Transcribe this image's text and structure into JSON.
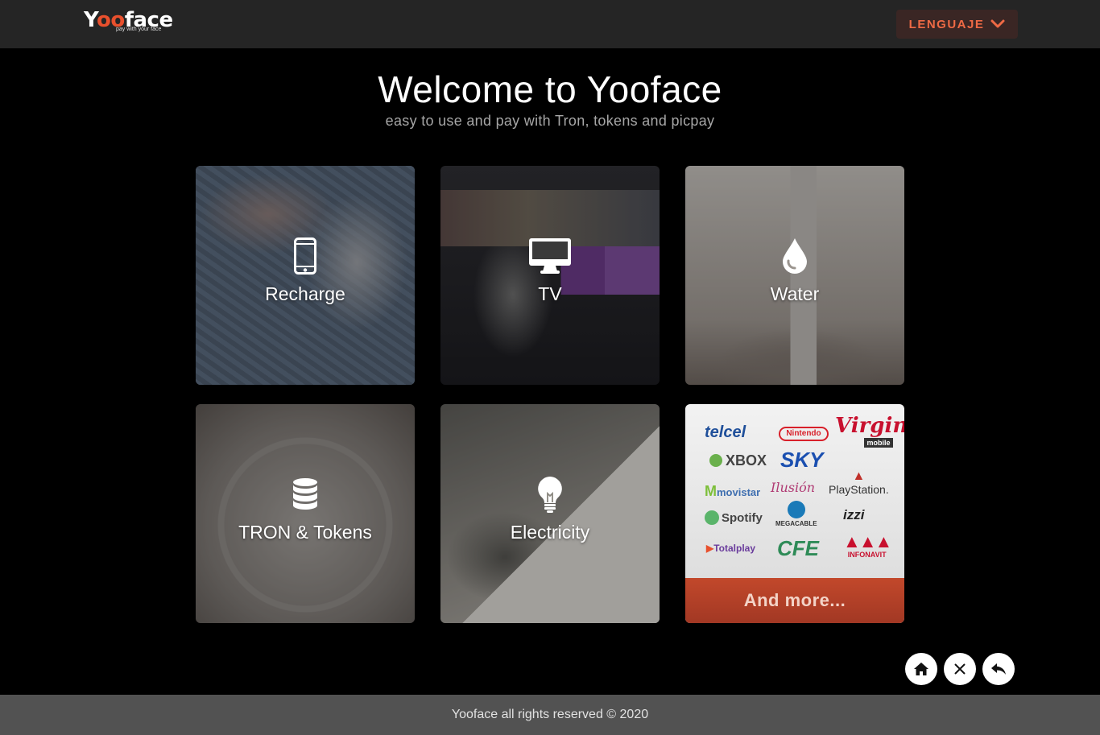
{
  "header": {
    "logo_word_start": "Y",
    "logo_word_oo": "oo",
    "logo_word_end": "face",
    "logo_tagline": "pay with your face",
    "language_button": "LENGUAJE",
    "language_icon": "chevron-down-icon"
  },
  "hero": {
    "title": "Welcome to Yooface",
    "subtitle": "easy to use and pay with Tron, tokens and picpay"
  },
  "cards": [
    {
      "label": "Recharge",
      "icon": "smartphone-icon"
    },
    {
      "label": "TV",
      "icon": "monitor-icon"
    },
    {
      "label": "Water",
      "icon": "droplet-icon"
    },
    {
      "label": "TRON & Tokens",
      "icon": "database-icon"
    },
    {
      "label": "Electricity",
      "icon": "lightbulb-icon"
    }
  ],
  "more_card": {
    "brands": [
      "telcel",
      "Nintendo",
      "Virgin",
      "mobile",
      "XBOX",
      "SKY",
      "movistar",
      "Ilusión",
      "PlayStation.",
      "Spotify",
      "MEGACABLE",
      "izzi",
      "Totalplay",
      "CFE",
      "INFONAVIT"
    ],
    "button": "And more..."
  },
  "actions": {
    "home_icon": "home-icon",
    "close_icon": "close-icon",
    "back_icon": "reply-arrow-icon"
  },
  "footer": {
    "text": "Yooface all rights reserved © 2020"
  },
  "colors": {
    "accent": "#ef6a45",
    "header_bg": "#252525",
    "footer_bg": "#525252",
    "more_bar": "#b0402a"
  }
}
